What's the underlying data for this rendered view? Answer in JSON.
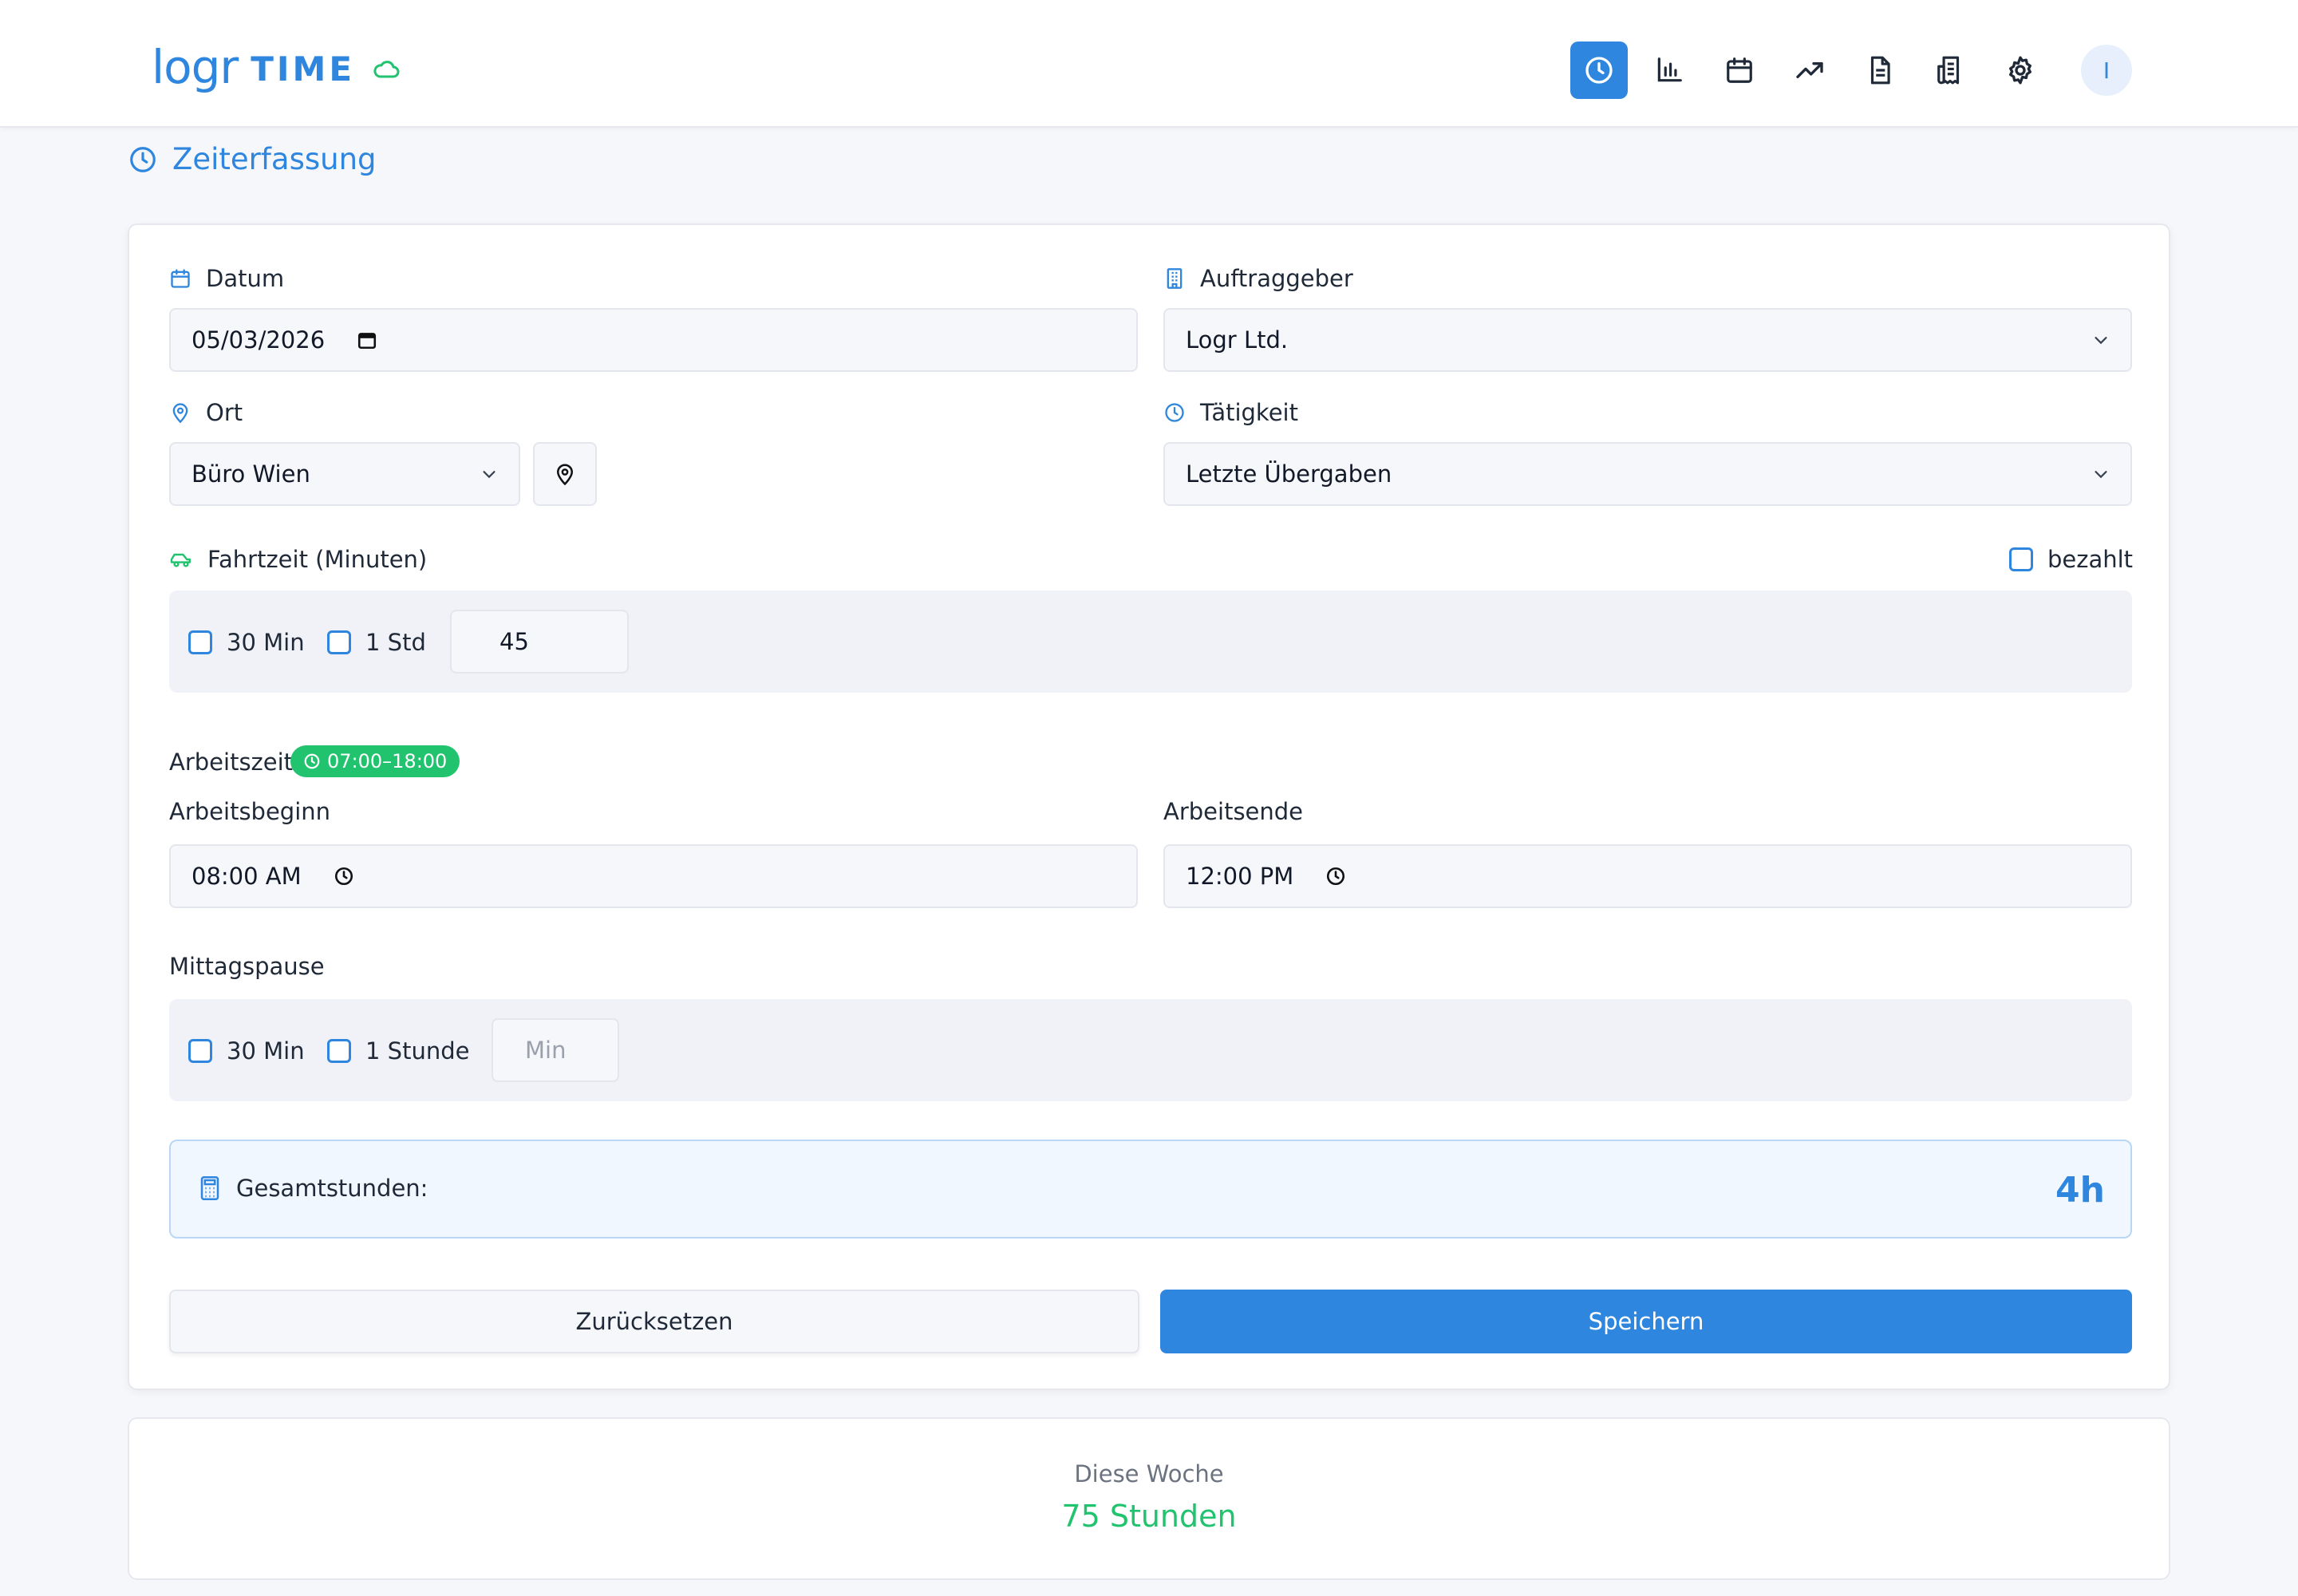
{
  "app": {
    "brand_logr": "logr",
    "brand_time": "TIME",
    "avatar_initial": "I"
  },
  "nav": [
    {
      "icon": "clock-icon",
      "active": true
    },
    {
      "icon": "bar-chart-icon",
      "active": false
    },
    {
      "icon": "calendar-icon",
      "active": false
    },
    {
      "icon": "trending-up-icon",
      "active": false
    },
    {
      "icon": "document-icon",
      "active": false
    },
    {
      "icon": "receipt-icon",
      "active": false
    },
    {
      "icon": "gear-icon",
      "active": false
    }
  ],
  "page": {
    "title": "Zeiterfassung"
  },
  "form": {
    "datum_label": "Datum",
    "datum_value": "05/03/2026",
    "auftraggeber_label": "Auftraggeber",
    "auftraggeber_value": "Logr Ltd.",
    "ort_label": "Ort",
    "ort_value": "Büro Wien",
    "taetigkeit_label": "Tätigkeit",
    "taetigkeit_value": "Letzte Übergaben",
    "fahrtzeit_label": "Fahrtzeit (Minuten)",
    "bezahlt_label": "bezahlt",
    "fahrt_opt1": "30 Min",
    "fahrt_opt2": "1 Std",
    "fahrt_value": "45",
    "arbeitszeit_label": "Arbeitszeit",
    "arbeitszeit_badge": "07:00–18:00",
    "beginn_label": "Arbeitsbeginn",
    "beginn_value": "08:00 AM",
    "ende_label": "Arbeitsende",
    "ende_value": "12:00 PM",
    "pause_label": "Mittagspause",
    "pause_opt1": "30 Min",
    "pause_opt2": "1 Stunde",
    "pause_placeholder": "Min",
    "gesamt_label": "Gesamtstunden:",
    "gesamt_value": "4h",
    "reset_label": "Zurücksetzen",
    "save_label": "Speichern"
  },
  "week": {
    "label": "Diese Woche",
    "value": "75 Stunden"
  },
  "colors": {
    "accent": "#2e86de",
    "success": "#22c36f",
    "background": "#f6f7fb"
  }
}
